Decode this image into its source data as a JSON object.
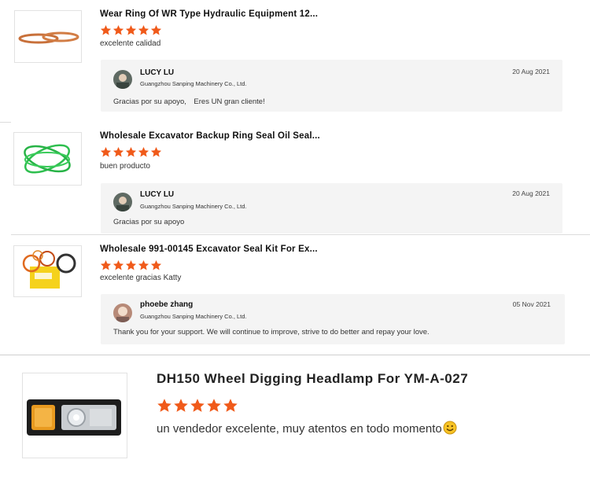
{
  "reviews": [
    {
      "title": "Wear Ring Of WR Type Hydraulic Equipment 12...",
      "rating": 5,
      "comment": "excelente calidad",
      "reply": {
        "name": "LUCY LU",
        "company": "Guangzhou Sanping Machinery Co., Ltd.",
        "date": "20 Aug 2021",
        "text": "Gracias por su apoyo,　Eres UN gran cliente!"
      }
    },
    {
      "title": "Wholesale Excavator Backup Ring Seal Oil Seal...",
      "rating": 5,
      "comment": "buen producto",
      "reply": {
        "name": "LUCY LU",
        "company": "Guangzhou Sanping Machinery Co., Ltd.",
        "date": "20 Aug 2021",
        "text": "Gracias por su apoyo"
      }
    },
    {
      "title": "Wholesale 991-00145 Excavator Seal Kit For Ex...",
      "rating": 5,
      "comment": "excelente gracias Katty",
      "reply": {
        "name": "phoebe zhang",
        "company": "Guangzhou Sanping Machinery Co., Ltd.",
        "date": "05 Nov 2021",
        "text": "Thank you for your support. We will continue to improve, strive to do better and repay your love."
      }
    },
    {
      "title": "DH150 Wheel Digging Headlamp For YM-A-027",
      "rating": 5,
      "comment": "un vendedor excelente, muy atentos en todo momento"
    }
  ],
  "colors": {
    "star": "#f05a1a",
    "reply_bg": "#f4f4f4"
  },
  "icons": [
    "star-icon",
    "avatar",
    "smile-emoji-icon"
  ]
}
